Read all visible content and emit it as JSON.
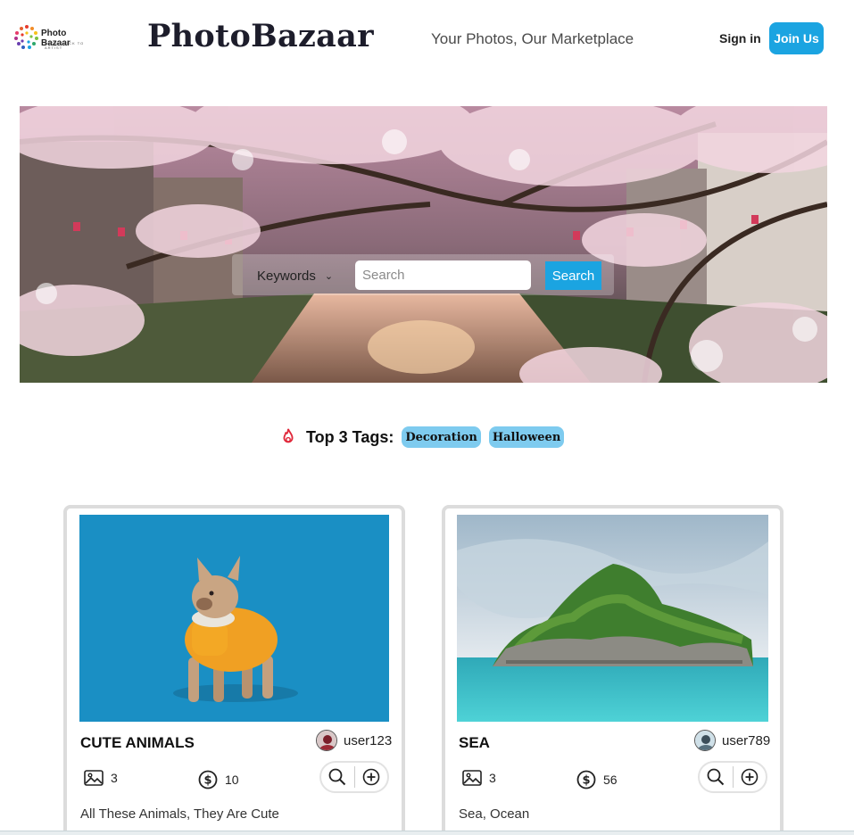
{
  "header": {
    "logo_name": "Photo Bazaar",
    "logo_sub": "FROM CLICK TO ARTIST",
    "brand": "PhotoBazaar",
    "tagline": "Your Photos, Our Marketplace",
    "signin_label": "Sign in",
    "join_label": "Join Us",
    "accent_color": "#1ba4e1"
  },
  "search": {
    "select_value": "Keywords",
    "placeholder": "Search",
    "button_label": "Search"
  },
  "tags": {
    "label": "Top 3 Tags:",
    "icon": "fire-icon",
    "items": [
      "Decoration",
      "Halloween"
    ]
  },
  "cards": [
    {
      "title": "CUTE ANIMALS",
      "user": "user123",
      "photos": "3",
      "price": "10",
      "description": "All These Animals, They Are Cute"
    },
    {
      "title": "SEA",
      "user": "user789",
      "photos": "3",
      "price": "56",
      "description": "Sea, Ocean"
    }
  ]
}
